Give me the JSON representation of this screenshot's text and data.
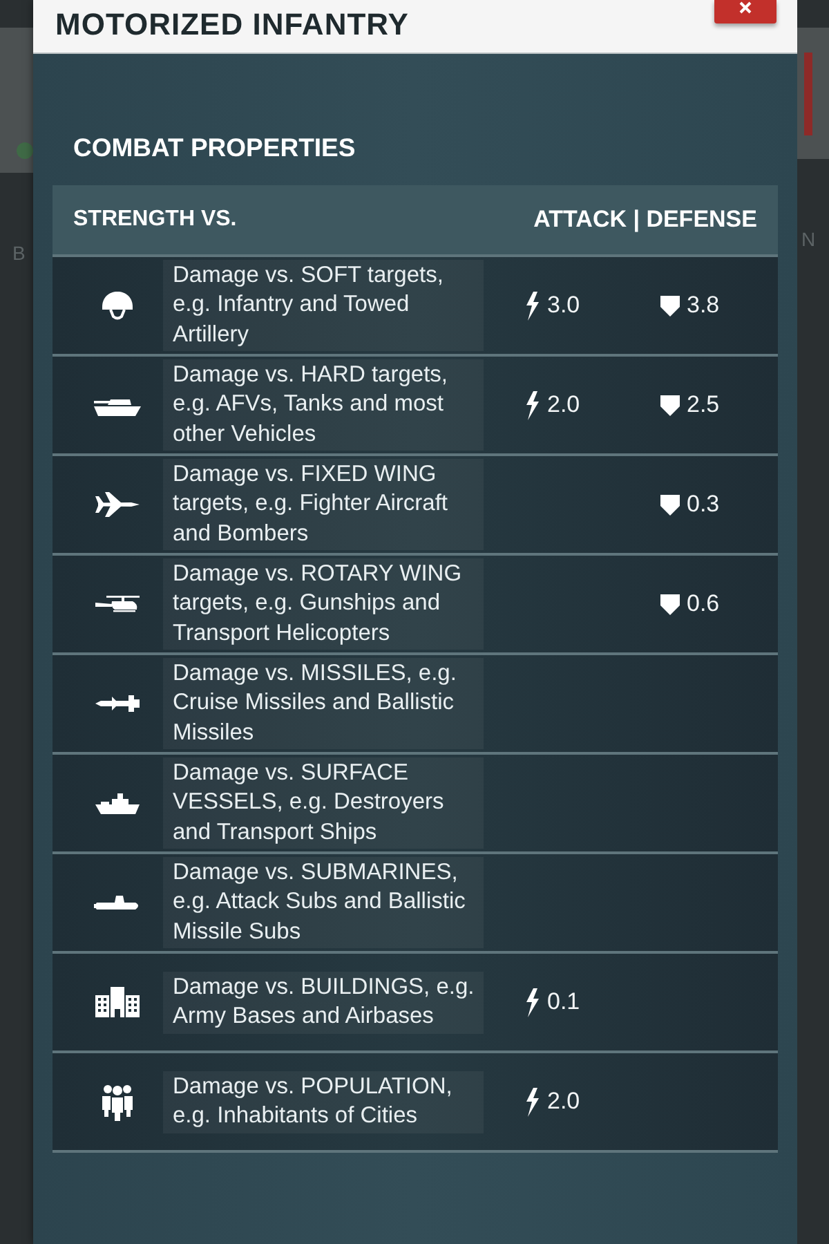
{
  "window": {
    "title": "MOTORIZED INFANTRY"
  },
  "backdrop": {
    "left_text": "B",
    "right_text": "N"
  },
  "section": {
    "title": "COMBAT PROPERTIES"
  },
  "table": {
    "columns": [
      "STRENGTH VS.",
      "ATTACK | DEFENSE"
    ],
    "rows": [
      {
        "kind": "helmet",
        "description": "Damage vs. SOFT targets, e.g. Infantry and Towed Artillery",
        "attack": "3.0",
        "defense": "3.8"
      },
      {
        "kind": "tank",
        "description": "Damage vs. HARD targets, e.g. AFVs, Tanks and most other Vehicles",
        "attack": "2.0",
        "defense": "2.5"
      },
      {
        "kind": "jet",
        "description": "Damage vs. FIXED WING targets, e.g. Fighter Aircraft and Bombers",
        "defense": "0.3"
      },
      {
        "kind": "helicopter",
        "description": "Damage vs. ROTARY WING targets, e.g. Gunships and Transport Helicopters",
        "defense": "0.6"
      },
      {
        "kind": "missile",
        "description": "Damage vs. MISSILES, e.g. Cruise Missiles and Ballistic Missiles"
      },
      {
        "kind": "ship",
        "description": "Damage vs. SURFACE VESSELS, e.g. Destroyers and Transport Ships"
      },
      {
        "kind": "submarine",
        "description": "Damage vs. SUBMARINES, e.g. Attack Subs and Ballistic Missile Subs"
      },
      {
        "kind": "building",
        "description": "Damage vs. BUILDINGS, e.g. Army Bases and Airbases",
        "attack": "0.1"
      },
      {
        "kind": "people",
        "description": "Damage vs. POPULATION, e.g. Inhabitants of Cities",
        "attack": "2.0"
      }
    ]
  }
}
